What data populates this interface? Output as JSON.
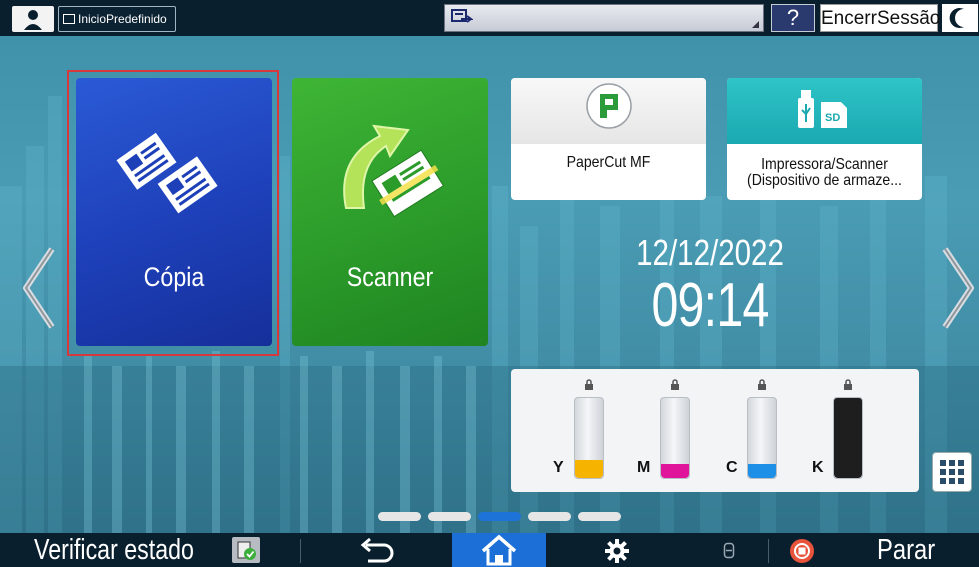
{
  "topbar": {
    "home_label": "InicioPredefinido",
    "help_label": "?",
    "logout_label": "EncerrSessão"
  },
  "tiles": {
    "copy": {
      "label": "Cópia"
    },
    "scanner": {
      "label": "Scanner"
    },
    "papercut": {
      "label": "PaperCut MF"
    },
    "storage": {
      "label_line1": "Impressora/Scanner",
      "label_line2": "(Dispositivo de armaze..."
    }
  },
  "clock": {
    "date": "12/12/2022",
    "time": "09:14"
  },
  "toner": [
    {
      "label": "Y",
      "level": 0.22,
      "color": "#f6b400"
    },
    {
      "label": "M",
      "level": 0.18,
      "color": "#e0149a"
    },
    {
      "label": "C",
      "level": 0.18,
      "color": "#1e8fe6"
    },
    {
      "label": "K",
      "level": 1.0,
      "color": "#1e1e1e"
    }
  ],
  "pager": {
    "pages": 5,
    "current": 3
  },
  "bottombar": {
    "check_status_label": "Verificar estado",
    "stop_label": "Parar"
  },
  "colors": {
    "accent_blue": "#1c6fd6",
    "copy_tile": "#1d3fb8",
    "scanner_tile": "#2b9b2a",
    "selection_border": "#d6393b"
  }
}
